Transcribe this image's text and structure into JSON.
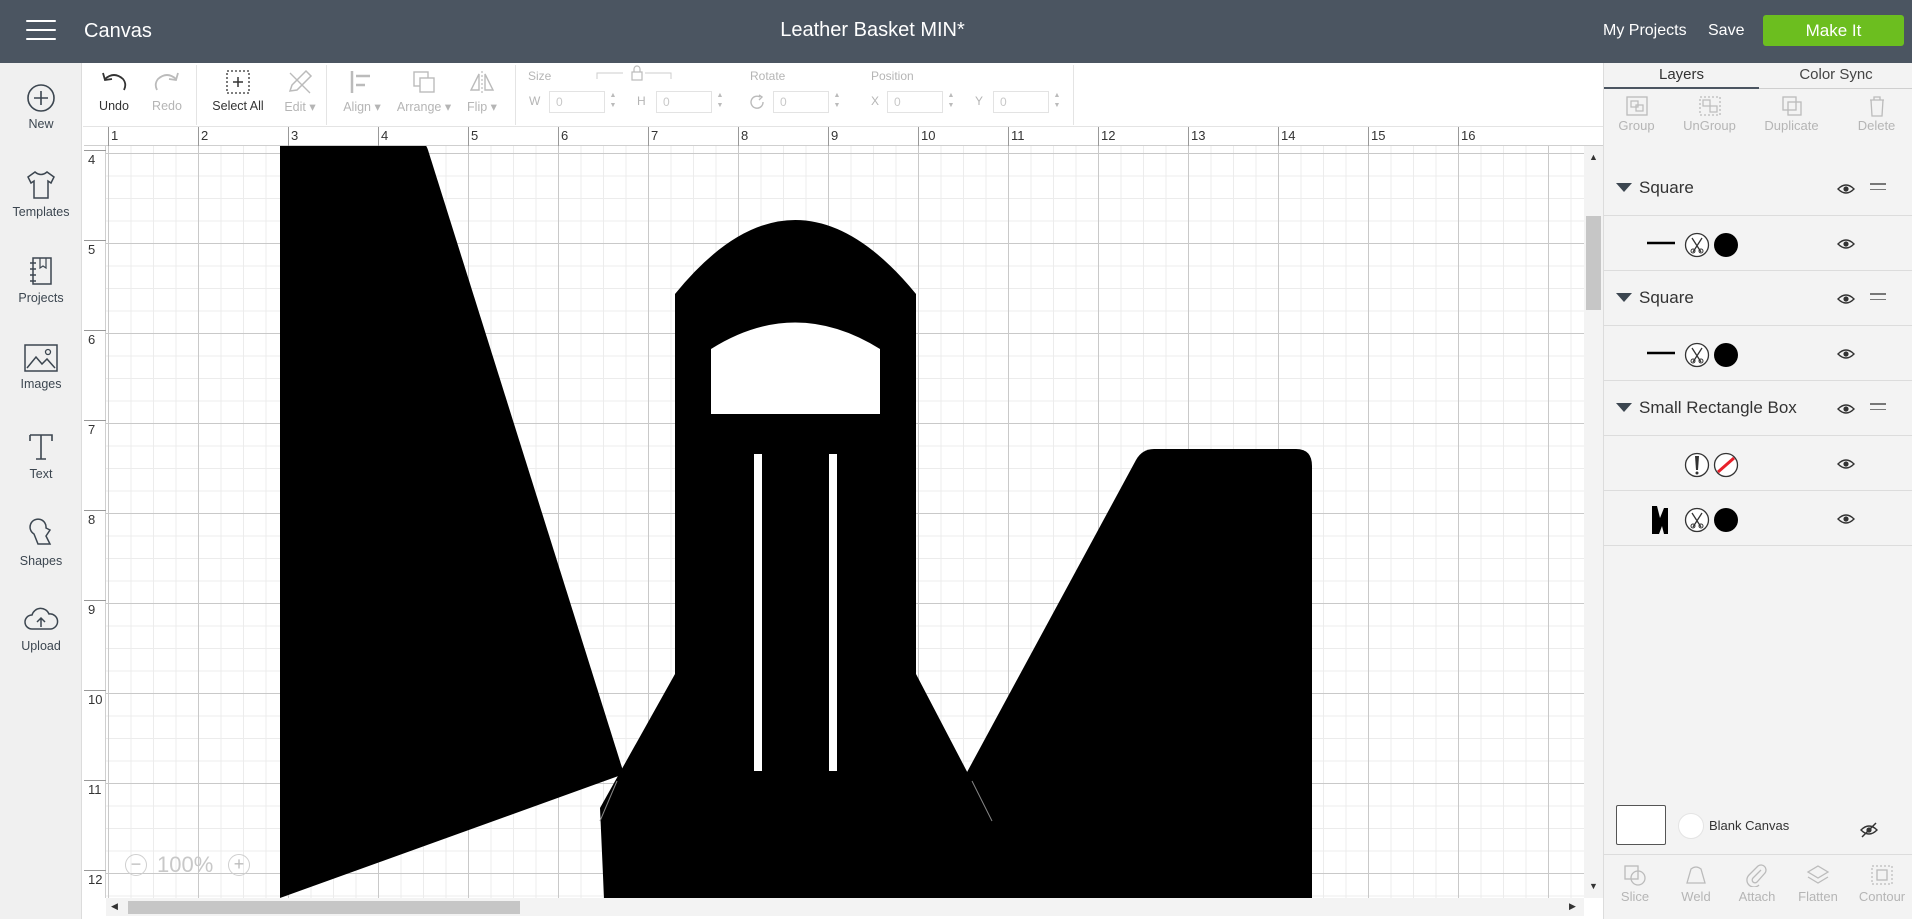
{
  "header": {
    "app_title": "Canvas",
    "doc_title": "Leather Basket MIN*",
    "my_projects": "My Projects",
    "save": "Save",
    "make_it": "Make It"
  },
  "sidebar": {
    "items": [
      {
        "label": "New",
        "icon": "plus-circle-icon"
      },
      {
        "label": "Templates",
        "icon": "tshirt-icon"
      },
      {
        "label": "Projects",
        "icon": "book-icon"
      },
      {
        "label": "Images",
        "icon": "image-icon"
      },
      {
        "label": "Text",
        "icon": "text-icon"
      },
      {
        "label": "Shapes",
        "icon": "shapes-icon"
      },
      {
        "label": "Upload",
        "icon": "cloud-upload-icon"
      }
    ]
  },
  "toolbar": {
    "undo": "Undo",
    "redo": "Redo",
    "select_all": "Select All",
    "edit": "Edit",
    "align": "Align",
    "arrange": "Arrange",
    "flip": "Flip",
    "size_label": "Size",
    "w_label": "W",
    "h_label": "H",
    "w_value": "0",
    "h_value": "0",
    "rotate_label": "Rotate",
    "rotate_value": "0",
    "position_label": "Position",
    "x_label": "X",
    "y_label": "Y",
    "x_value": "0",
    "y_value": "0"
  },
  "ruler": {
    "top": [
      "1",
      "2",
      "3",
      "4",
      "5",
      "6",
      "7",
      "8",
      "9",
      "10",
      "11",
      "12",
      "13",
      "14",
      "15",
      "16"
    ],
    "left": [
      "4",
      "5",
      "6",
      "7",
      "8",
      "9",
      "10",
      "11",
      "12"
    ]
  },
  "zoom": {
    "minus": "−",
    "value": "100%",
    "plus": "+"
  },
  "panel": {
    "tabs": [
      "Layers",
      "Color Sync"
    ],
    "tools": [
      "Group",
      "UnGroup",
      "Duplicate",
      "Delete"
    ],
    "groups": [
      {
        "name": "Square"
      },
      {
        "name": "Square"
      },
      {
        "name": "Small Rectangle Box"
      }
    ],
    "blank_canvas": "Blank Canvas",
    "bottom_tools": [
      "Slice",
      "Weld",
      "Attach",
      "Flatten",
      "Contour"
    ]
  },
  "colors": {
    "header_bg": "#4b5561",
    "make_it": "#6cbe1f",
    "shape_fill": "#000000",
    "score_red": "#e8202a"
  }
}
